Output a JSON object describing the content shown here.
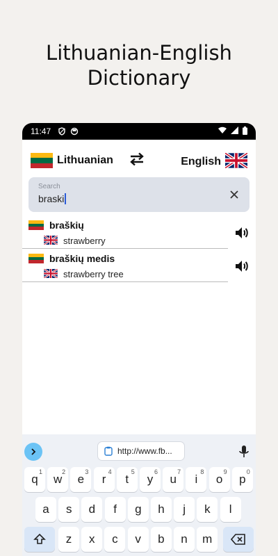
{
  "promo": {
    "line1": "Lithuanian-English",
    "line2": "Dictionary"
  },
  "status": {
    "time": "11:47",
    "icons": [
      "shield-icon",
      "circle-icon"
    ],
    "right_icons": [
      "wifi-icon",
      "signal-icon",
      "battery-icon"
    ]
  },
  "languages": {
    "source": "Lithuanian",
    "target": "English",
    "source_flag": "lithuania-flag",
    "target_flag": "uk-flag"
  },
  "search": {
    "placeholder": "Search",
    "value": "braski"
  },
  "results": [
    {
      "lt": "braškių",
      "en": "strawberry"
    },
    {
      "lt": "braškių medis",
      "en": "strawberry tree"
    }
  ],
  "keyboard": {
    "url_chip": "http://www.fb...",
    "row1": [
      {
        "k": "q",
        "s": "1"
      },
      {
        "k": "w",
        "s": "2"
      },
      {
        "k": "e",
        "s": "3"
      },
      {
        "k": "r",
        "s": "4"
      },
      {
        "k": "t",
        "s": "5"
      },
      {
        "k": "y",
        "s": "6"
      },
      {
        "k": "u",
        "s": "7"
      },
      {
        "k": "i",
        "s": "8"
      },
      {
        "k": "o",
        "s": "9"
      },
      {
        "k": "p",
        "s": "0"
      }
    ],
    "row2": [
      "a",
      "s",
      "d",
      "f",
      "g",
      "h",
      "j",
      "k",
      "l"
    ],
    "row3": [
      "z",
      "x",
      "c",
      "v",
      "b",
      "n",
      "m"
    ]
  },
  "colors": {
    "accent": "#6bc3f5",
    "searchbg": "#dde1e9",
    "keyboardbg": "#eef1f6",
    "modkey": "#d9e6f7"
  }
}
